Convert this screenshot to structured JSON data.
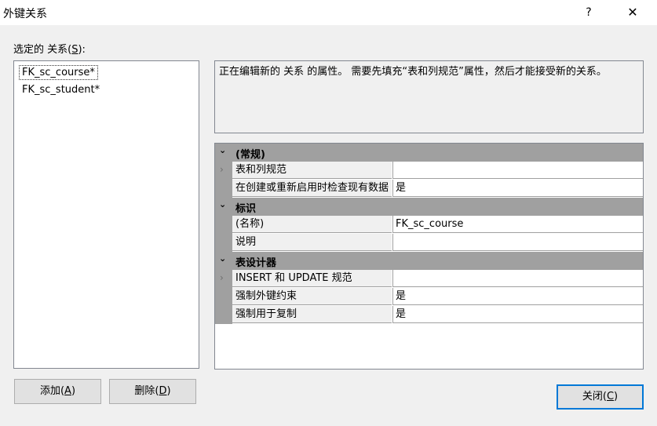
{
  "window": {
    "title": "外键关系",
    "help": "?",
    "close": "✕"
  },
  "left": {
    "selected_label": "选定的 关系(",
    "selected_key": "S",
    "selected_tail": "):",
    "items": [
      "FK_sc_course*",
      "FK_sc_student*"
    ]
  },
  "description": "正在编辑新的 关系 的属性。 需要先填充“表和列规范”属性，然后才能接受新的关系。",
  "grid": {
    "general": {
      "label": "(常规)",
      "spec_name": "表和列规范",
      "spec_value": "",
      "check_name": "在创建或重新启用时检查现有数据",
      "check_value": "是"
    },
    "identity": {
      "label": "标识",
      "name_name": "(名称)",
      "name_value": "FK_sc_course",
      "desc_name": "说明",
      "desc_value": ""
    },
    "designer": {
      "label": "表设计器",
      "iu_name": "INSERT 和 UPDATE 规范",
      "iu_value": "",
      "enforce_name": "强制外键约束",
      "enforce_value": "是",
      "repl_name": "强制用于复制",
      "repl_value": "是"
    }
  },
  "buttons": {
    "add": {
      "pre": "添加(",
      "key": "A",
      "post": ")"
    },
    "delete": {
      "pre": "删除(",
      "key": "D",
      "post": ")"
    },
    "close": {
      "pre": "关闭(",
      "key": "C",
      "post": ")"
    }
  }
}
